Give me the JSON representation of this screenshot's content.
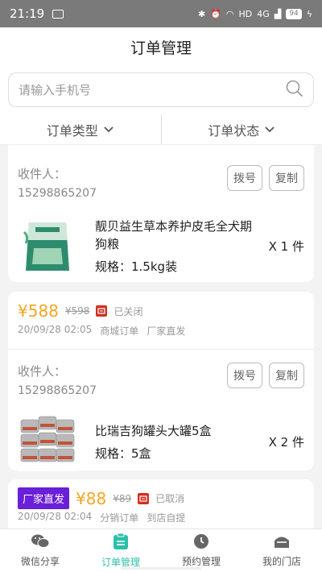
{
  "status_bar": {
    "time": "21:19",
    "network": "HD",
    "signal": "4G",
    "battery": "94"
  },
  "header": {
    "title": "订单管理"
  },
  "search": {
    "placeholder": "请输入手机号",
    "value": ""
  },
  "filters": [
    {
      "label": "订单类型"
    },
    {
      "label": "订单状态"
    }
  ],
  "orders": [
    {
      "receiver_label": "收件人：",
      "receiver_phone": "15298865207",
      "actions": {
        "dial": "拨号",
        "copy": "复制"
      },
      "product": {
        "name": "靓贝益生草本养护皮毛全犬期狗粮",
        "spec": "规格：1.5kg装",
        "qty": "X 1 件"
      }
    },
    {
      "price": "¥588",
      "old_price": "¥598",
      "status": "已关闭",
      "datetime": "20/09/28 02:05",
      "order_type": "商城订单",
      "delivery": "厂家直发",
      "receiver_label": "收件人：",
      "receiver_phone": "15298865207",
      "actions": {
        "dial": "拨号",
        "copy": "复制"
      },
      "product": {
        "name": "比瑞吉狗罐头大罐5盒",
        "spec": "规格：5盒",
        "qty": "X 2 件"
      }
    },
    {
      "tag": "厂家直发",
      "price": "¥88",
      "old_price": "¥89",
      "status": "已取消",
      "datetime": "20/09/28 02:04",
      "order_type": "分销订单",
      "delivery": "到店自提"
    }
  ],
  "tabbar": [
    {
      "label": "微信分享",
      "icon": "wechat-icon",
      "active": false
    },
    {
      "label": "订单管理",
      "icon": "order-list-icon",
      "active": true
    },
    {
      "label": "预约管理",
      "icon": "clock-icon",
      "active": false
    },
    {
      "label": "我的门店",
      "icon": "store-icon",
      "active": false
    }
  ],
  "colors": {
    "accent": "#2cbfa8",
    "price": "#f5a623",
    "tag": "#6a1fd8",
    "status_icon": "#d0301f"
  }
}
